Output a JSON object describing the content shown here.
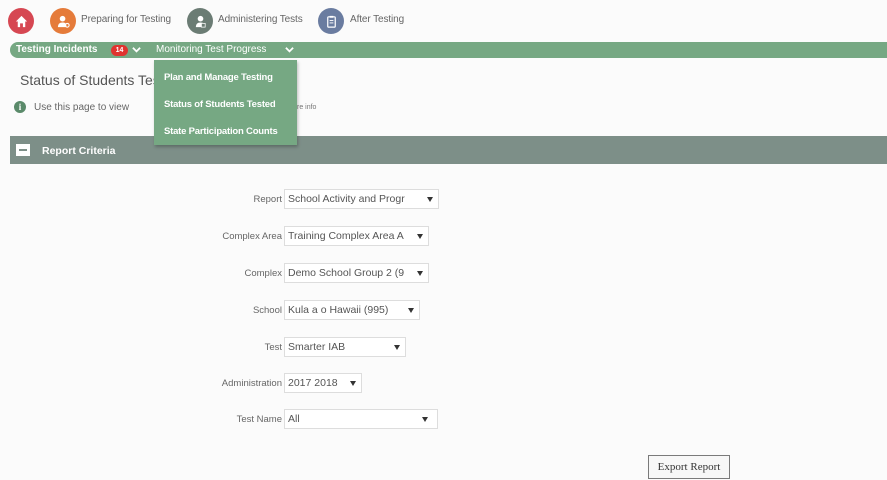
{
  "topnav": {
    "items": [
      {
        "label": "",
        "icon": "home-icon",
        "color": "#d64752"
      },
      {
        "label": "Preparing for Testing",
        "icon": "user-gear-icon",
        "color": "#e57b3a"
      },
      {
        "label": "Administering Tests",
        "icon": "user-proctor-icon",
        "color": "#6b7c74"
      },
      {
        "label": "After Testing",
        "icon": "clipboard-icon",
        "color": "#6a7ca0"
      }
    ]
  },
  "greenbar": {
    "testing_incidents": "Testing Incidents",
    "incidents_count": "14",
    "monitoring": "Monitoring Test Progress"
  },
  "page": {
    "title": "Status of Students Tested",
    "info_text": "Use this page to view",
    "info_more": "re info"
  },
  "menu": {
    "items": [
      "Plan and Manage Testing",
      "Status of Students Tested",
      "State Participation Counts"
    ]
  },
  "criteria": {
    "label": "Report Criteria"
  },
  "form": {
    "fields": [
      {
        "label": "Report",
        "value": "School Activity and Progr"
      },
      {
        "label": "Complex Area",
        "value": "Training Complex Area A"
      },
      {
        "label": "Complex",
        "value": "Demo School Group 2 (9"
      },
      {
        "label": "School",
        "value": "Kula a o Hawaii (995)"
      },
      {
        "label": "Test",
        "value": "Smarter IAB"
      },
      {
        "label": "Administration",
        "value": "2017 2018"
      },
      {
        "label": "Test Name",
        "value": "All"
      }
    ],
    "export_label": "Export Report"
  },
  "colors": {
    "nav_green": "#76a883",
    "criteria_gray": "#7d8f88",
    "badge_red": "#e0332f"
  }
}
